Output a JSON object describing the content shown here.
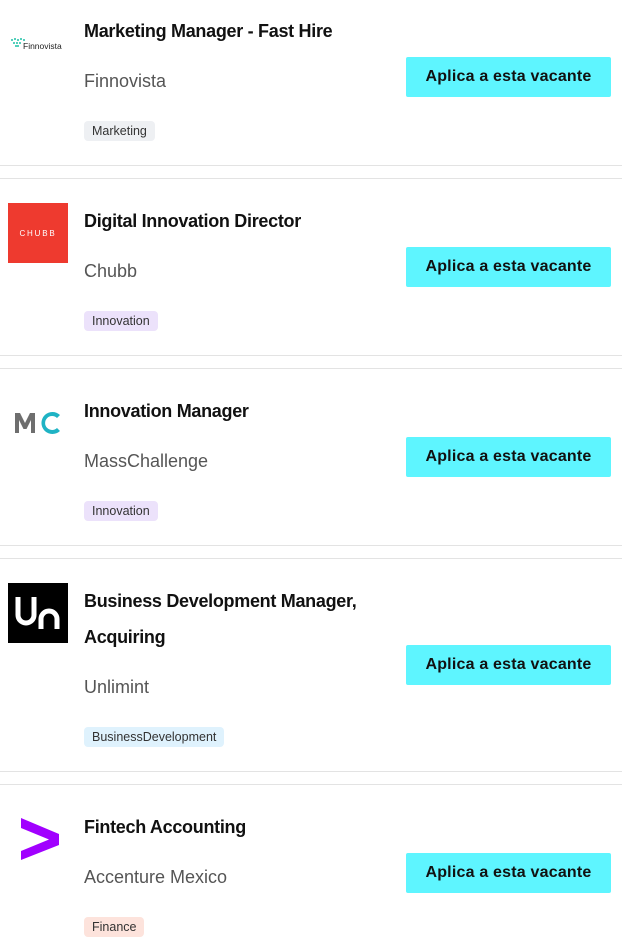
{
  "jobs": [
    {
      "title": "Marketing Manager - Fast Hire",
      "company": "Finnovista",
      "tag": "Marketing",
      "logo_text": "Finnovista",
      "apply_label": "Aplica a esta vacante"
    },
    {
      "title": "Digital Innovation Director",
      "company": "Chubb",
      "tag": "Innovation",
      "logo_text": "CHUBB",
      "apply_label": "Aplica a esta vacante"
    },
    {
      "title": "Innovation Manager",
      "company": "MassChallenge",
      "tag": "Innovation",
      "logo_text": "MC",
      "apply_label": "Aplica a esta vacante"
    },
    {
      "title": "Business Development Manager, Acquiring",
      "company": "Unlimint",
      "tag": "BusinessDevelopment",
      "logo_text": "Un",
      "apply_label": "Aplica a esta vacante"
    },
    {
      "title": "Fintech Accounting",
      "company": "Accenture Mexico",
      "tag": "Finance",
      "logo_text": "",
      "apply_label": "Aplica a esta vacante"
    }
  ],
  "colors": {
    "apply_button": "#5ef5ff",
    "chubb_red": "#ee3a2f",
    "masschallenge_teal": "#1fb3c4",
    "accenture_purple": "#a100ff"
  }
}
